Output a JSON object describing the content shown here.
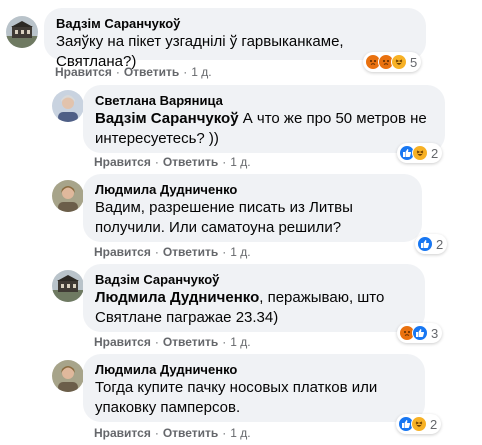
{
  "comments": [
    {
      "author": "Вадзім Саранчукоў",
      "mention": "",
      "text": "Заяўку на пікет узгаднілі ў гарвыканкаме, Святлана?)",
      "like": "Нравится",
      "reply": "Ответить",
      "time": "1 д.",
      "reactions": [
        "angry",
        "angry",
        "haha"
      ],
      "count": "5"
    },
    {
      "author": "Светлана Варяница",
      "mention": "Вадзім Саранчукоў",
      "text": "А что же про 50 метров не интересуетесь? ))",
      "like": "Нравится",
      "reply": "Ответить",
      "time": "1 д.",
      "reactions": [
        "like",
        "haha"
      ],
      "count": "2"
    },
    {
      "author": "Людмила Дудниченко",
      "mention": "",
      "text": "Вадим, разрешение писать из Литвы получили. Или саматоуна решили?",
      "like": "Нравится",
      "reply": "Ответить",
      "time": "1 д.",
      "reactions": [
        "like"
      ],
      "count": "2"
    },
    {
      "author": "Вадзім Саранчукоў",
      "mention": "Людмила Дудниченко",
      "text": ", перажываю, што Святлане пагражае 23.34)",
      "like": "Нравится",
      "reply": "Ответить",
      "time": "1 д.",
      "reactions": [
        "angry",
        "like"
      ],
      "count": "3"
    },
    {
      "author": "Людмила Дудниченко",
      "mention": "",
      "text": "Тогда купите пачку носовых платков или упаковку памперсов.",
      "like": "Нравится",
      "reply": "Ответить",
      "time": "1 д.",
      "reactions": [
        "like",
        "haha"
      ],
      "count": "2"
    }
  ],
  "separator": "·",
  "colors": {
    "like": "#1877f2",
    "angry": "#e9710f",
    "haha": "#f7b125",
    "bubble": "#f0f2f5",
    "meta": "#65676b"
  }
}
